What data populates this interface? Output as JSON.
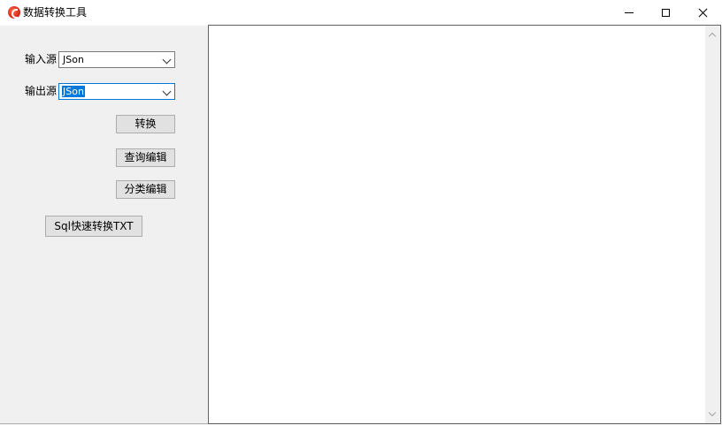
{
  "window": {
    "title": "数据转换工具",
    "icon": "app-logo-icon"
  },
  "form": {
    "input_label": "输入源",
    "input_value": "JSon",
    "output_label": "输出源",
    "output_value": "JSon",
    "convert_button": "转换",
    "query_edit_button": "查询编辑",
    "category_edit_button": "分类编辑",
    "sql_quick_button": "Sql快速转换TXT"
  },
  "colors": {
    "selection": "#0078d7",
    "close_hover": "#e81123"
  }
}
